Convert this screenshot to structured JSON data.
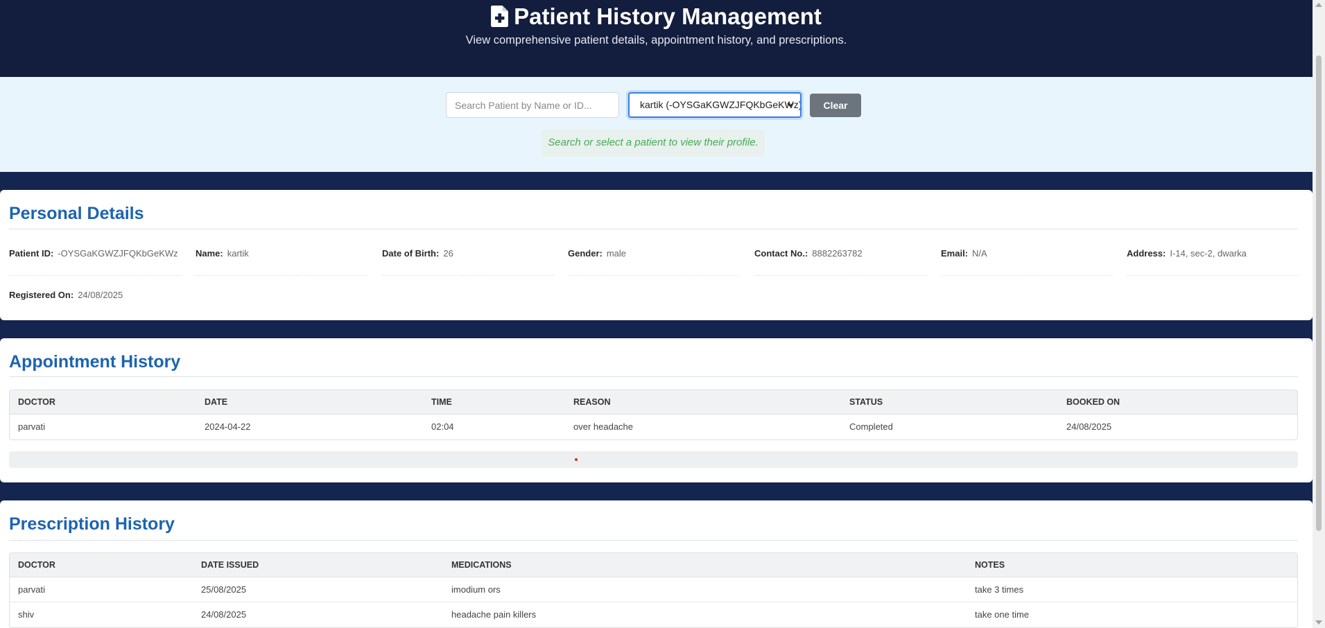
{
  "header": {
    "title": "Patient History Management",
    "subtitle": "View comprehensive patient details, appointment history, and prescriptions.",
    "icon": "file-medical-icon"
  },
  "search": {
    "placeholder": "Search Patient by Name or ID...",
    "value": "",
    "selected_patient": "kartik (-OYSGaKGWZJFQKbGeKWz)",
    "clear_label": "Clear",
    "hint": "Search or select a patient to view their profile."
  },
  "personal": {
    "title": "Personal Details",
    "fields": [
      {
        "label": "Patient ID:",
        "value": "-OYSGaKGWZJFQKbGeKWz"
      },
      {
        "label": "Name:",
        "value": "kartik"
      },
      {
        "label": "Date of Birth:",
        "value": "26"
      },
      {
        "label": "Gender:",
        "value": "male"
      },
      {
        "label": "Contact No.:",
        "value": "8882263782"
      },
      {
        "label": "Email:",
        "value": "N/A"
      },
      {
        "label": "Address:",
        "value": "I-14, sec-2, dwarka"
      },
      {
        "label": "Registered On:",
        "value": "24/08/2025"
      }
    ]
  },
  "appointments": {
    "title": "Appointment History",
    "columns": [
      "DOCTOR",
      "DATE",
      "TIME",
      "REASON",
      "STATUS",
      "BOOKED ON"
    ],
    "rows": [
      [
        "parvati",
        "2024-04-22",
        "02:04",
        "over headache",
        "Completed",
        "24/08/2025"
      ]
    ]
  },
  "prescriptions": {
    "title": "Prescription History",
    "columns": [
      "DOCTOR",
      "DATE ISSUED",
      "MEDICATIONS",
      "NOTES"
    ],
    "rows": [
      [
        "parvati",
        "25/08/2025",
        "imodium ors",
        "take 3 times"
      ],
      [
        "shiv",
        "24/08/2025",
        "headache pain killers",
        "take one time"
      ]
    ]
  },
  "colors": {
    "header_bg": "#131d3d",
    "accent_blue": "#1d63b0",
    "hint_green": "#46a958",
    "clear_button": "#6c757d"
  }
}
